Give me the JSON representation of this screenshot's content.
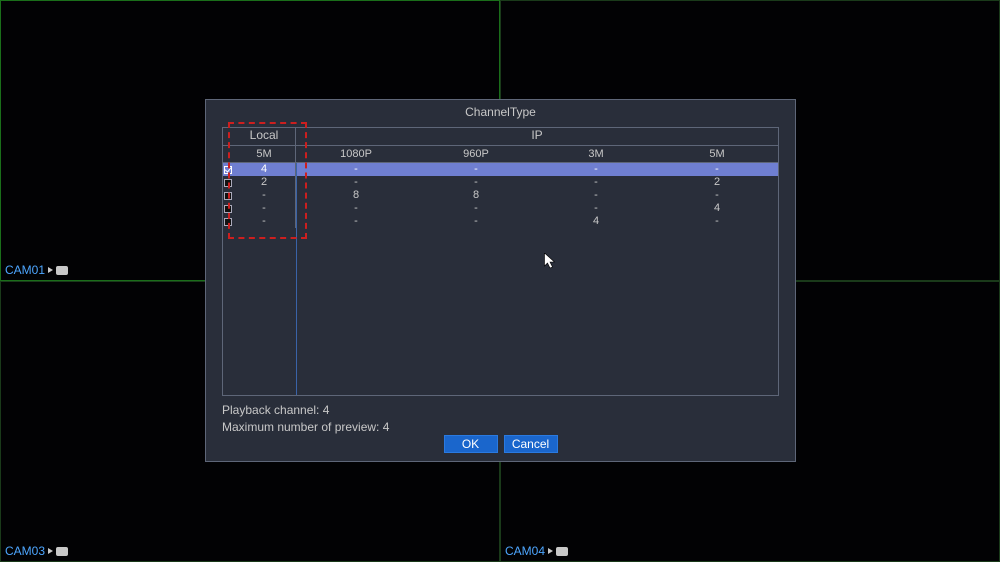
{
  "cameras": {
    "tl": "CAM01",
    "tr": "",
    "bl": "CAM03",
    "br": "CAM04"
  },
  "dialog": {
    "title": "ChannelType",
    "group_local": "Local",
    "group_ip": "IP",
    "columns": {
      "local5m": "5M",
      "c1080p": "1080P",
      "c960p": "960P",
      "c3m": "3M",
      "ip5m": "5M"
    },
    "rows": [
      {
        "selected": true,
        "local5m": "4",
        "c1080p": "-",
        "c960p": "-",
        "c3m": "-",
        "ip5m": "-"
      },
      {
        "selected": false,
        "local5m": "2",
        "c1080p": "-",
        "c960p": "-",
        "c3m": "-",
        "ip5m": "2"
      },
      {
        "selected": false,
        "local5m": "-",
        "c1080p": "8",
        "c960p": "8",
        "c3m": "-",
        "ip5m": "-"
      },
      {
        "selected": false,
        "local5m": "-",
        "c1080p": "-",
        "c960p": "-",
        "c3m": "-",
        "ip5m": "4"
      },
      {
        "selected": false,
        "local5m": "-",
        "c1080p": "-",
        "c960p": "-",
        "c3m": "4",
        "ip5m": "-"
      }
    ],
    "footer1": "Playback channel: 4",
    "footer2": "Maximum number of preview: 4",
    "ok": "OK",
    "cancel": "Cancel"
  }
}
